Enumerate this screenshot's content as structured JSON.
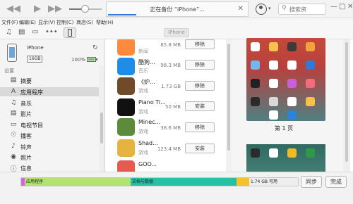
{
  "toolbar": {
    "status_text": "正在备份 “iPhone”...",
    "search_placeholder": "搜索资",
    "back_icon": "rewind-icon",
    "play_icon": "play-icon",
    "forward_icon": "fast-forward-icon"
  },
  "menu": [
    "文件(F)",
    "编辑(E)",
    "显示(V)",
    "控制(C)",
    "商店(S)",
    "帮助(H)"
  ],
  "media_bar": {
    "device_label": "iPhone"
  },
  "device": {
    "name": "iPhone",
    "capacity": "16GB",
    "battery": "100%"
  },
  "sidebar": {
    "section_title": "设置",
    "items": [
      {
        "label": "摘要",
        "icon": "summary-icon"
      },
      {
        "label": "应用程序",
        "icon": "apps-icon"
      },
      {
        "label": "音乐",
        "icon": "music-note-icon"
      },
      {
        "label": "影片",
        "icon": "movie-icon"
      },
      {
        "label": "电视节目",
        "icon": "tv-icon"
      },
      {
        "label": "播客",
        "icon": "podcast-icon"
      },
      {
        "label": "铃声",
        "icon": "bell-icon"
      },
      {
        "label": "照片",
        "icon": "camera-icon"
      },
      {
        "label": "信息",
        "icon": "info-icon"
      }
    ]
  },
  "apps": [
    {
      "name": "",
      "category": "新闻",
      "size": "85.8 MB",
      "action": "移除",
      "color": "#ff8a3d"
    },
    {
      "name": "酷狗...",
      "category": "音乐",
      "size": "98.3 MB",
      "action": "移除",
      "color": "#1d8de8"
    },
    {
      "name": "《炉...",
      "category": "游戏",
      "size": "1.73 GB",
      "action": "移除",
      "color": "#6f4a2b"
    },
    {
      "name": "Piano Ti...",
      "category": "游戏",
      "size": "50 MB",
      "action": "安装",
      "color": "#111111"
    },
    {
      "name": "Minec...",
      "category": "游戏",
      "size": "38.6 MB",
      "action": "移除",
      "color": "#5c8b3b"
    },
    {
      "name": "Shad...",
      "category": "游戏",
      "size": "123.4 MB",
      "action": "安装",
      "color": "#e5b43f"
    },
    {
      "name": "GOO...",
      "category": "",
      "size": "",
      "action": "",
      "color": "#e65a4f"
    }
  ],
  "preview": {
    "page_label": "第 1 页"
  },
  "storage": {
    "segments": [
      {
        "label": "应用程序",
        "color": "#b0e36f"
      },
      {
        "label": "文档与数据",
        "color": "#26c0a4"
      },
      {
        "label": "",
        "color": "#f3c329"
      },
      {
        "label": "1.74 GB 可用",
        "color": "#eeeeee"
      }
    ],
    "sync_label": "同步",
    "done_label": "完成"
  }
}
